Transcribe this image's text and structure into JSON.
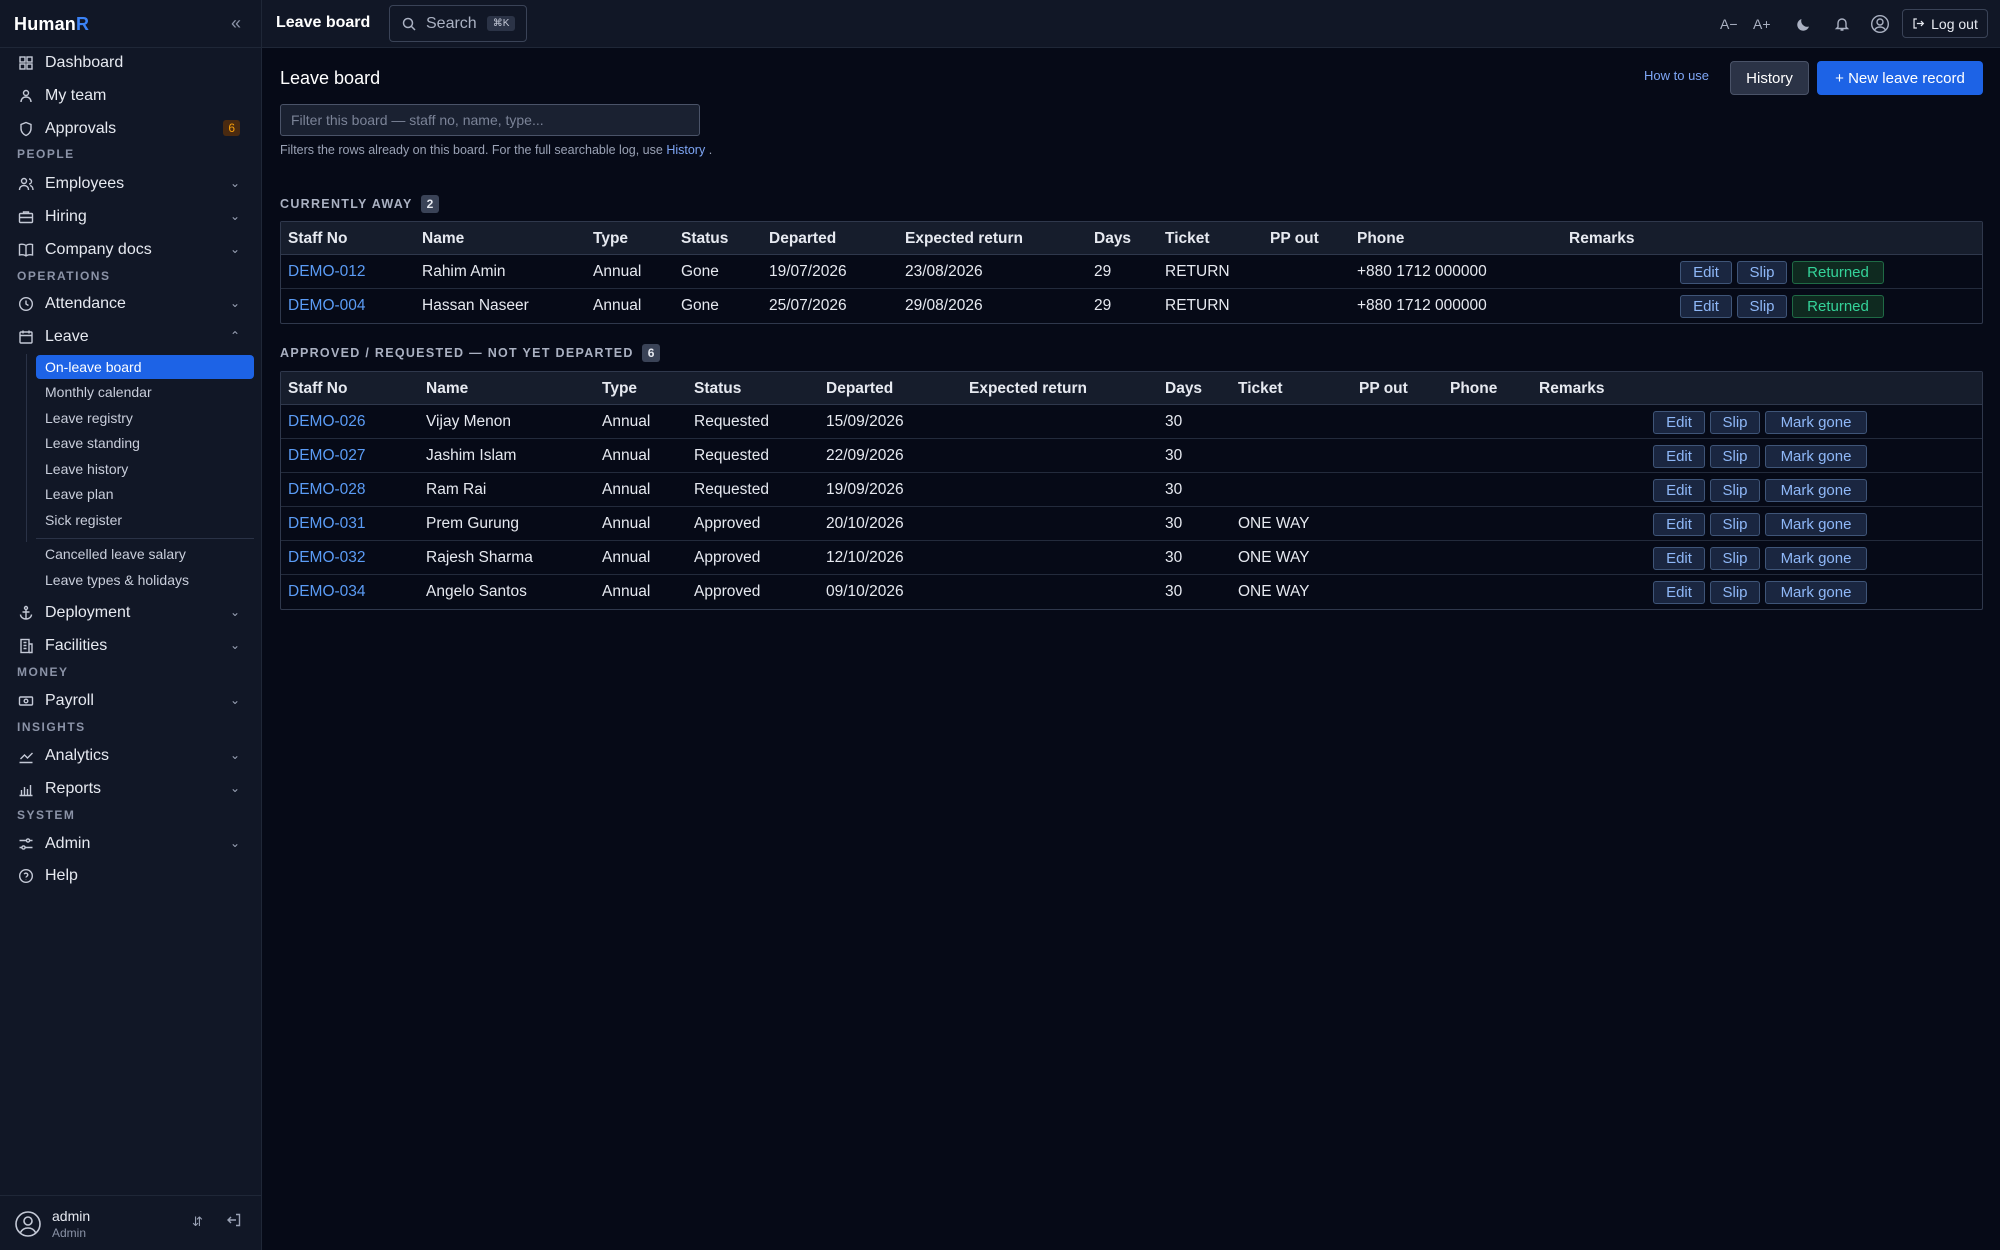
{
  "brand": {
    "name": "Human",
    "suffix": "R"
  },
  "topbar": {
    "title": "Leave board",
    "search_label": "Search",
    "search_kbd": "⌘K",
    "font_dec": "A−",
    "font_inc": "A+",
    "logout_label": "Log out"
  },
  "sidebar": {
    "dashboard": "Dashboard",
    "my_team": "My team",
    "approvals": "Approvals",
    "approvals_count": "6",
    "section_people": "PEOPLE",
    "employees": "Employees",
    "hiring": "Hiring",
    "company_docs": "Company docs",
    "section_operations": "OPERATIONS",
    "attendance": "Attendance",
    "leave": "Leave",
    "leave_sub": [
      "On-leave board",
      "Monthly calendar",
      "Leave registry",
      "Leave standing",
      "Leave history",
      "Leave plan",
      "Sick register",
      "Cancelled leave salary",
      "Leave types & holidays"
    ],
    "deployment": "Deployment",
    "facilities": "Facilities",
    "section_money": "MONEY",
    "payroll": "Payroll",
    "section_insights": "INSIGHTS",
    "analytics": "Analytics",
    "reports": "Reports",
    "section_system": "SYSTEM",
    "admin": "Admin",
    "help": "Help"
  },
  "user": {
    "name": "admin",
    "role": "Admin"
  },
  "main": {
    "title": "Leave board",
    "how_to": "How to use",
    "history_btn": "History",
    "new_btn": "+ New leave record",
    "filter_placeholder": "Filter this board — staff no, name, type...",
    "hint_text": "Filters the rows already on this board. For the full searchable log, use",
    "hint_link": "History",
    "hint_end": "."
  },
  "away": {
    "heading": "CURRENTLY AWAY",
    "count": "2",
    "columns": [
      "Staff No",
      "Name",
      "Type",
      "Status",
      "Departed",
      "Expected return",
      "Days",
      "Ticket",
      "PP out",
      "Phone",
      "Remarks"
    ],
    "rows": [
      {
        "staff": "DEMO-012",
        "name": "Rahim Amin",
        "type": "Annual",
        "status": "Gone",
        "departed": "19/07/2026",
        "ret": "23/08/2026",
        "days": "29",
        "ticket": "RETURN",
        "pp": "",
        "phone": "+880 1712 000000",
        "remarks": ""
      },
      {
        "staff": "DEMO-004",
        "name": "Hassan Naseer",
        "type": "Annual",
        "status": "Gone",
        "departed": "25/07/2026",
        "ret": "29/08/2026",
        "days": "29",
        "ticket": "RETURN",
        "pp": "",
        "phone": "+880 1712 000000",
        "remarks": ""
      }
    ],
    "actions": {
      "edit": "Edit",
      "slip": "Slip",
      "returned": "Returned"
    }
  },
  "pending": {
    "heading": "APPROVED / REQUESTED — NOT YET DEPARTED",
    "count": "6",
    "columns": [
      "Staff No",
      "Name",
      "Type",
      "Status",
      "Departed",
      "Expected return",
      "Days",
      "Ticket",
      "PP out",
      "Phone",
      "Remarks"
    ],
    "rows": [
      {
        "staff": "DEMO-026",
        "name": "Vijay Menon",
        "type": "Annual",
        "status": "Requested",
        "departed": "15/09/2026",
        "ret": "",
        "days": "30",
        "ticket": "",
        "pp": "",
        "phone": "",
        "remarks": ""
      },
      {
        "staff": "DEMO-027",
        "name": "Jashim Islam",
        "type": "Annual",
        "status": "Requested",
        "departed": "22/09/2026",
        "ret": "",
        "days": "30",
        "ticket": "",
        "pp": "",
        "phone": "",
        "remarks": ""
      },
      {
        "staff": "DEMO-028",
        "name": "Ram Rai",
        "type": "Annual",
        "status": "Requested",
        "departed": "19/09/2026",
        "ret": "",
        "days": "30",
        "ticket": "",
        "pp": "",
        "phone": "",
        "remarks": ""
      },
      {
        "staff": "DEMO-031",
        "name": "Prem Gurung",
        "type": "Annual",
        "status": "Approved",
        "departed": "20/10/2026",
        "ret": "",
        "days": "30",
        "ticket": "ONE WAY",
        "pp": "",
        "phone": "",
        "remarks": ""
      },
      {
        "staff": "DEMO-032",
        "name": "Rajesh Sharma",
        "type": "Annual",
        "status": "Approved",
        "departed": "12/10/2026",
        "ret": "",
        "days": "30",
        "ticket": "ONE WAY",
        "pp": "",
        "phone": "",
        "remarks": ""
      },
      {
        "staff": "DEMO-034",
        "name": "Angelo Santos",
        "type": "Annual",
        "status": "Approved",
        "departed": "09/10/2026",
        "ret": "",
        "days": "30",
        "ticket": "ONE WAY",
        "pp": "",
        "phone": "",
        "remarks": ""
      }
    ],
    "actions": {
      "edit": "Edit",
      "slip": "Slip",
      "mark_gone": "Mark gone"
    }
  }
}
